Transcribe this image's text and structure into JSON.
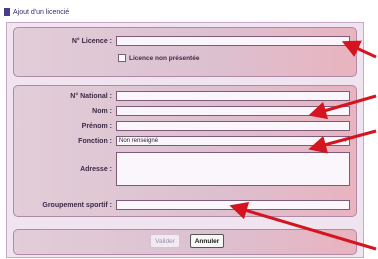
{
  "window": {
    "title": "Ajout d'un licencié"
  },
  "form": {
    "licence_label": "N° Licence :",
    "licence_absent_label": "Licence non présentée",
    "national_label": "N° National :",
    "nom_label": "Nom :",
    "prenom_label": "Prénom :",
    "fonction_label": "Fonction :",
    "fonction_value": "Non renseigné",
    "adresse_label": "Adresse :",
    "groupement_label": "Groupement sportif :"
  },
  "buttons": {
    "valider": "Valider",
    "annuler": "Annuler"
  },
  "colors": {
    "arrow": "#d4141f",
    "panel": "#dcc0d0"
  }
}
